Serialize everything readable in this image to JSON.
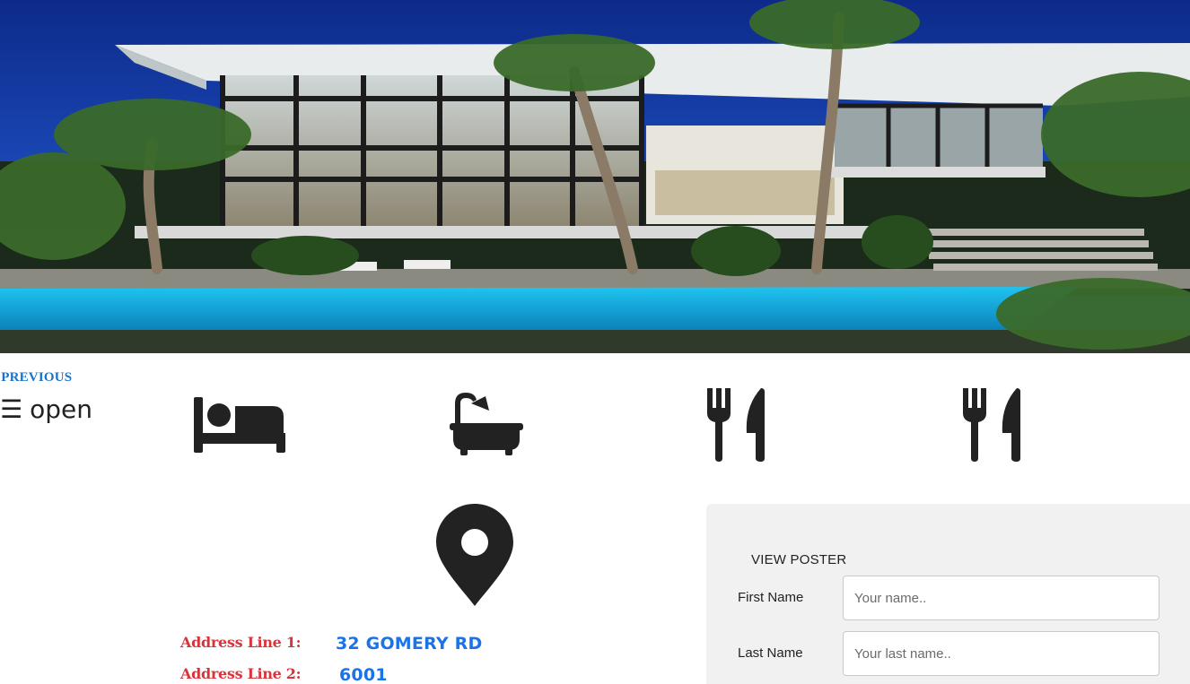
{
  "hero": {
    "image_alt": "Modern villa with pool at dusk"
  },
  "nav": {
    "previous_label": "PREVIOUS",
    "open_label": "open"
  },
  "amenities": [
    {
      "icon": "bed-icon"
    },
    {
      "icon": "bath-icon"
    },
    {
      "icon": "dining-icon"
    },
    {
      "icon": "dining-icon"
    }
  ],
  "address": {
    "line1_label": "Address Line 1:",
    "line1_value": "32 GOMERY RD",
    "line2_label": "Address Line 2:",
    "line2_value": "6001"
  },
  "form": {
    "poster_label": "VIEW POSTER",
    "first_name_label": "First Name",
    "first_name_placeholder": "Your name..",
    "last_name_label": "Last Name",
    "last_name_placeholder": "Your last name.."
  },
  "colors": {
    "link": "#1a73c8",
    "address_label": "#d9343c",
    "address_value": "#1a73e8",
    "icon": "#222222",
    "panel_bg": "#f1f1f1"
  }
}
